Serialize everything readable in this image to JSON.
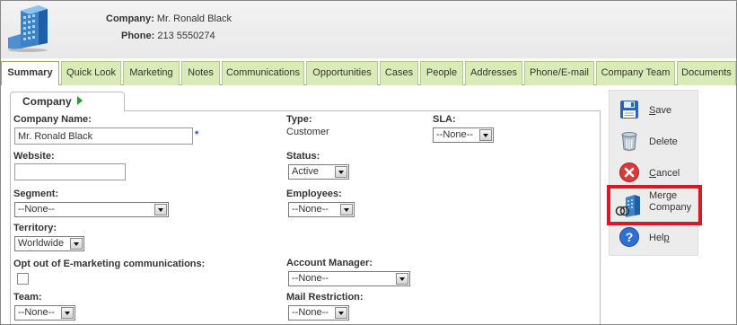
{
  "header": {
    "company_label": "Company:",
    "company_value": "Mr. Ronald Black",
    "phone_label": "Phone:",
    "phone_value": "213 5550274",
    "logo_icon": "building-logo-icon"
  },
  "tabs": [
    {
      "label": "Summary",
      "active": true
    },
    {
      "label": "Quick Look"
    },
    {
      "label": "Marketing"
    },
    {
      "label": "Notes"
    },
    {
      "label": "Communications"
    },
    {
      "label": "Opportunities"
    },
    {
      "label": "Cases"
    },
    {
      "label": "People"
    },
    {
      "label": "Addresses"
    },
    {
      "label": "Phone/E-mail"
    },
    {
      "label": "Company Team"
    },
    {
      "label": "Documents"
    }
  ],
  "panel": {
    "title": "Company",
    "fields": {
      "company_name": {
        "label": "Company Name:",
        "value": "Mr. Ronald Black",
        "required_mark": "*"
      },
      "website": {
        "label": "Website:",
        "value": ""
      },
      "segment": {
        "label": "Segment:",
        "value": "--None--"
      },
      "territory": {
        "label": "Territory:",
        "value": "Worldwide"
      },
      "opt_out": {
        "label": "Opt out of E-marketing communications:",
        "checked": false
      },
      "team": {
        "label": "Team:",
        "value": "--None--"
      },
      "type": {
        "label": "Type:",
        "value": "Customer"
      },
      "sla": {
        "label": "SLA:",
        "value": "--None--"
      },
      "status": {
        "label": "Status:",
        "value": "Active"
      },
      "employees": {
        "label": "Employees:",
        "value": "--None--"
      },
      "account_manager": {
        "label": "Account Manager:",
        "value": "--None--"
      },
      "mail_restriction": {
        "label": "Mail Restriction:",
        "value": "--None--"
      }
    }
  },
  "actions": {
    "save": {
      "label_u": "S",
      "label_rest": "ave",
      "icon": "floppy-disk-icon"
    },
    "delete": {
      "label": "Delete",
      "icon": "trash-can-icon"
    },
    "cancel": {
      "label_u": "C",
      "label_rest": "ancel",
      "icon": "cancel-x-icon"
    },
    "merge": {
      "line1": "Merge",
      "line2": "Company",
      "icon": "merge-company-icon"
    },
    "help": {
      "label_pre": "Hel",
      "label_u": "p",
      "icon": "help-question-icon"
    }
  },
  "colors": {
    "tab_bg": "#d9ebb7",
    "tab_border": "#b5c98f",
    "highlight": "#d31b24",
    "required": "#1a4fc4",
    "panel_arrow": "#2e9a26"
  }
}
